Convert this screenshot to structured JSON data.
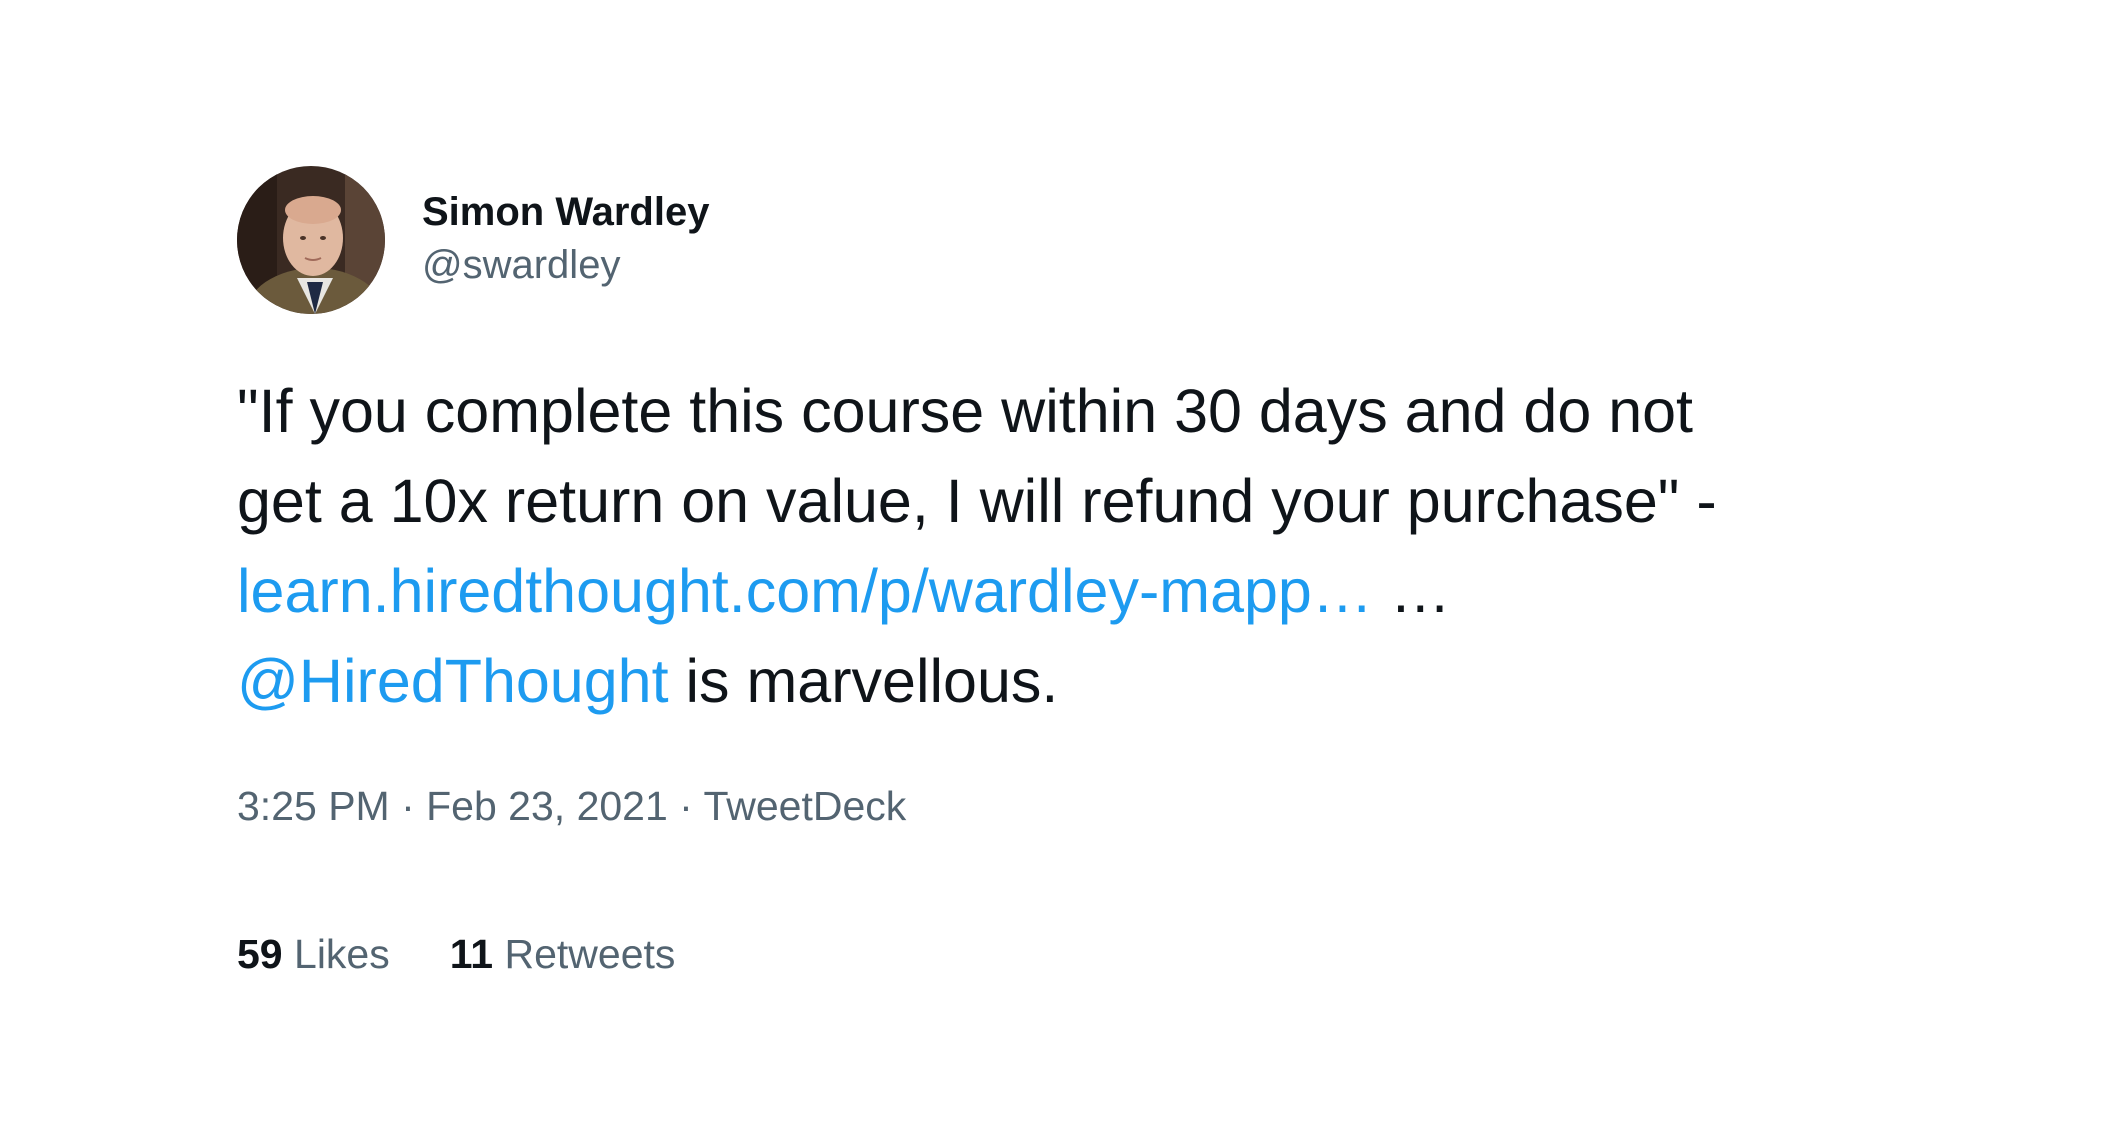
{
  "author": {
    "display_name": "Simon Wardley",
    "handle": "@swardley"
  },
  "tweet": {
    "line1": "\"If you complete this course within 30 days and do not",
    "line2": "get a 10x return on value, I will refund your purchase\" -",
    "link_text": "learn.hiredthought.com/p/wardley-mapp…",
    "link_suffix": " …",
    "mention": "@HiredThought",
    "mention_suffix": " is marvellous."
  },
  "meta": {
    "time": "3:25 PM",
    "separator": " · ",
    "date": "Feb 23, 2021",
    "source": "TweetDeck"
  },
  "stats": {
    "likes_count": "59",
    "likes_label": "Likes",
    "retweets_count": "11",
    "retweets_label": "Retweets"
  },
  "colors": {
    "link": "#1d9bf0",
    "secondary_text": "#536471",
    "primary_text": "#0f1419"
  },
  "icons": {
    "avatar": "profile-photo"
  }
}
